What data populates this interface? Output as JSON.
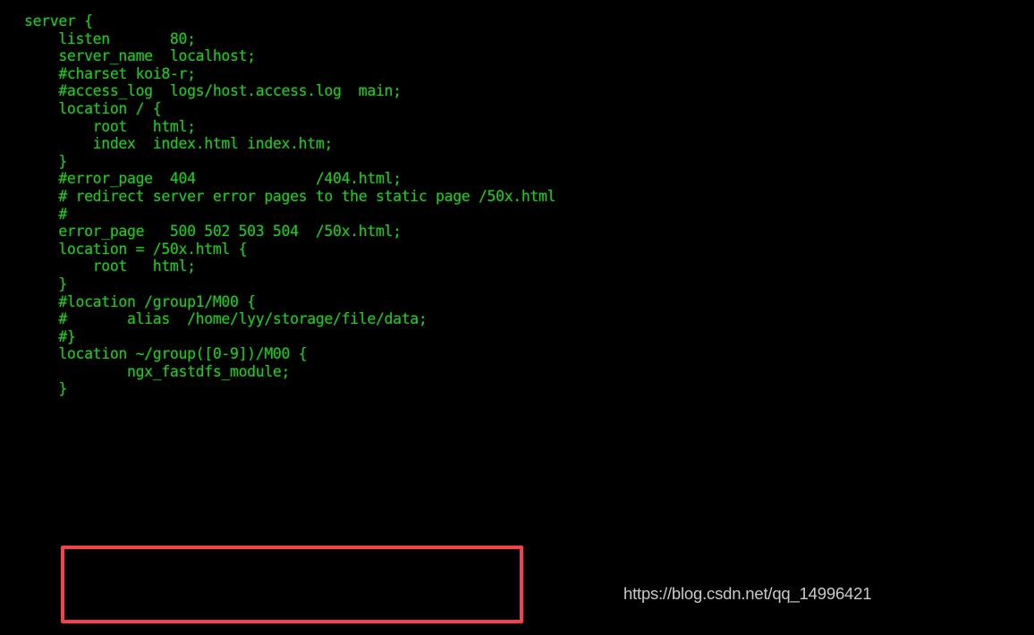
{
  "terminal": {
    "background_color": "#000000",
    "text_color": "#25c425",
    "language": "nginx-conf",
    "lines": [
      "server {",
      "    listen       80;",
      "    server_name  localhost;",
      "",
      "    #charset koi8-r;",
      "",
      "    #access_log  logs/host.access.log  main;",
      "",
      "    location / {",
      "        root   html;",
      "        index  index.html index.htm;",
      "    }",
      "",
      "",
      "    #error_page  404              /404.html;",
      "",
      "    # redirect server error pages to the static page /50x.html",
      "    #",
      "    error_page   500 502 503 504  /50x.html;",
      "    location = /50x.html {",
      "        root   html;",
      "    }",
      "",
      "    #location /group1/M00 {",
      "    #       alias  /home/lyy/storage/file/data;",
      "    #}",
      "",
      "    location ~/group([0-9])/M00 {",
      "            ngx_fastdfs_module;",
      "    }",
      ""
    ]
  },
  "highlight": {
    "label": "fastdfs-location-block-highlight",
    "color": "#f4424a",
    "border_width": "4px",
    "highlighted_lines": [
      "    location ~/group([0-9])/M00 {",
      "            ngx_fastdfs_module;",
      "    }"
    ]
  },
  "watermark": {
    "text": "https://blog.csdn.net/qq_14996421",
    "color": "#c9c9c9"
  }
}
